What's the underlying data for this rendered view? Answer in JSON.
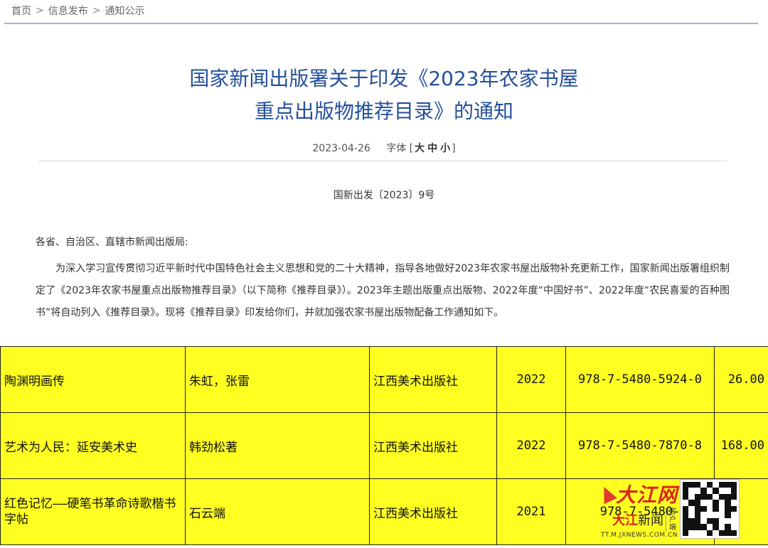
{
  "breadcrumb": {
    "items": [
      "首页",
      "信息发布",
      "通知公示"
    ],
    "separator": ">"
  },
  "article": {
    "title_line1": "国家新闻出版署关于印发《2023年农家书屋",
    "title_line2": "重点出版物推荐目录》的通知",
    "date": "2023-04-26",
    "font_size_label": "字体",
    "font_size_open": "[",
    "font_size_options": [
      "大",
      "中",
      "小"
    ],
    "font_size_close": "]",
    "doc_number": "国新出发〔2023〕9号",
    "salutation": "各省、自治区、直辖市新闻出版局:",
    "paragraph": "为深入学习宣传贯彻习近平新时代中国特色社会主义思想和党的二十大精神，指导各地做好2023年农家书屋出版物补充更新工作，国家新闻出版署组织制定了《2023年农家书屋重点出版物推荐目录》（以下简称《推荐目录》）。2023年主题出版重点出版物、2022年度“中国好书”、2022年度“农民喜爱的百种图书”将自动列入《推荐目录》。现将《推荐目录》印发给你们，并就加强农家书屋出版物配备工作通知如下。"
  },
  "book_table": {
    "rows": [
      {
        "title": "陶渊明画传",
        "author": "朱虹，张雷",
        "publisher": "江西美术出版社",
        "year": "2022",
        "isbn": "978-7-5480-5924-0",
        "price": "26.00"
      },
      {
        "title": "艺术为人民：延安美术史",
        "author": "韩劲松著",
        "publisher": "江西美术出版社",
        "year": "2022",
        "isbn": "978-7-5480-7870-8",
        "price": "168.00"
      },
      {
        "title": "红色记忆——硬笔书革命诗歌楷书字帖",
        "author": "石云端",
        "publisher": "江西美术出版社",
        "year": "2021",
        "isbn": "978-7-5480-",
        "price": ""
      }
    ],
    "highlight_color": "#fefe20"
  },
  "watermark": {
    "brand": "大江网",
    "news_prefix": "大江",
    "news_suffix": "新闻",
    "client_label": "客户端",
    "url": "TT.M.JXNEWS.COM.CN",
    "brand_color": "#d8261a"
  },
  "colors": {
    "title": "#24509a",
    "rule": "#9cb8d4"
  }
}
